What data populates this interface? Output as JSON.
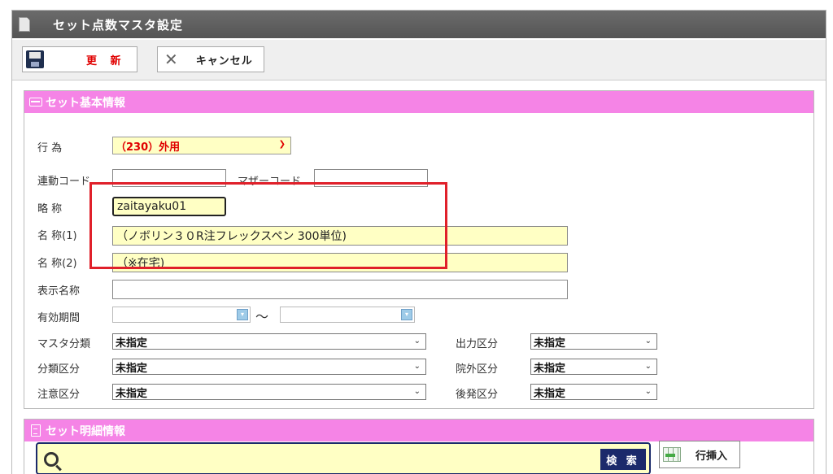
{
  "window": {
    "title": "セット点数マスタ設定"
  },
  "toolbar": {
    "save_label": "更 新",
    "cancel_label": "キャンセル"
  },
  "basic_panel": {
    "header": "セット基本情報",
    "act_label": "行 為",
    "act_value": "（230）外用",
    "link_code_label": "連動コード",
    "link_code_value": "",
    "mother_code_label": "マザーコード",
    "mother_code_value": "",
    "short_name_label": "略 称",
    "short_name_value": "zaitayaku01",
    "name1_label": "名 称(1)",
    "name1_value": "（ノボリン３０R注フレックスペン 300単位)",
    "name2_label": "名 称(2)",
    "name2_value": "（※在宅)",
    "display_name_label": "表示名称",
    "display_name_value": "",
    "valid_period_label": "有効期間",
    "period_start": "",
    "period_end": "",
    "period_separator": "～",
    "master_class_label": "マスタ分類",
    "master_class_value": "未指定",
    "category_label": "分類区分",
    "category_value": "未指定",
    "caution_label": "注意区分",
    "caution_value": "未指定",
    "output_label": "出力区分",
    "output_value": "未指定",
    "outside_label": "院外区分",
    "outside_value": "未指定",
    "generic_label": "後発区分",
    "generic_value": "未指定"
  },
  "detail_panel": {
    "header": "セット明細情報",
    "search_value": "",
    "search_button": "検 索",
    "insert_row_button": "行挿入"
  },
  "colors": {
    "panel_header": "#f584e6",
    "required_field": "#ffffc4",
    "highlight": "#e0202a",
    "save_text": "#e00000"
  }
}
